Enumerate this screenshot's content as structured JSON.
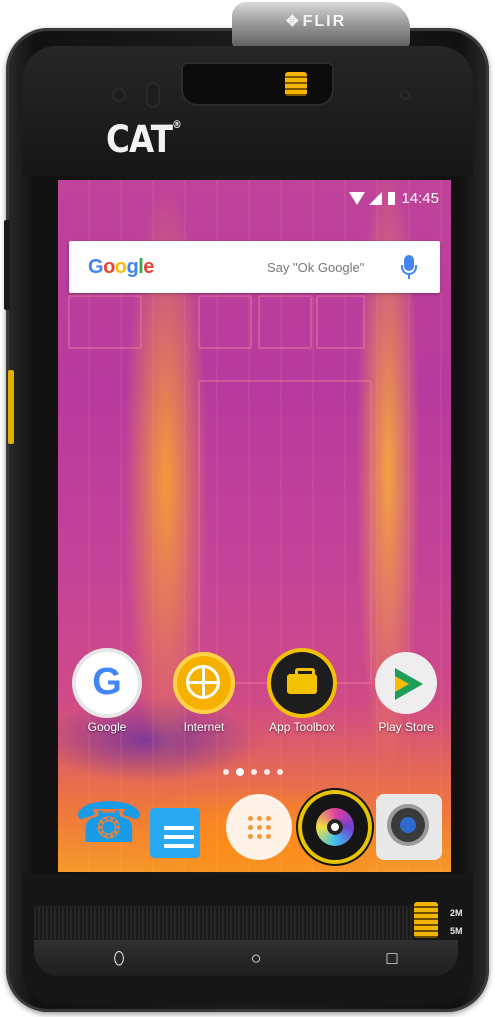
{
  "device": {
    "brand_logo": "CAT",
    "camera_brand": "FLIR",
    "capture_labels": [
      "2M",
      "5M"
    ]
  },
  "status_bar": {
    "time": "14:45",
    "icons": [
      "wifi-icon",
      "signal-icon",
      "battery-icon"
    ]
  },
  "search_widget": {
    "logo": "Google",
    "hint": "Say \"Ok Google\"",
    "mic_icon": "mic-icon"
  },
  "home_apps": [
    {
      "label": "Google",
      "icon": "google-icon"
    },
    {
      "label": "Internet",
      "icon": "globe-icon"
    },
    {
      "label": "App Toolbox",
      "icon": "toolbox-icon"
    },
    {
      "label": "Play Store",
      "icon": "play-store-icon"
    }
  ],
  "page_indicator": {
    "count": 5,
    "active_index": 1
  },
  "dock": [
    {
      "icon": "phone-icon"
    },
    {
      "icon": "messages-icon"
    },
    {
      "icon": "app-drawer-icon"
    },
    {
      "icon": "flir-camera-icon"
    },
    {
      "icon": "camera-icon"
    }
  ],
  "nav_keys": [
    {
      "icon": "back-icon",
      "glyph": "⬯"
    },
    {
      "icon": "home-icon",
      "glyph": "○"
    },
    {
      "icon": "recents-icon",
      "glyph": "□"
    }
  ],
  "colors": {
    "flir_yellow": "#f2b400",
    "google_blue": "#4285f4",
    "thermal_magenta": "#c0439a",
    "thermal_orange": "#f59a2a"
  }
}
